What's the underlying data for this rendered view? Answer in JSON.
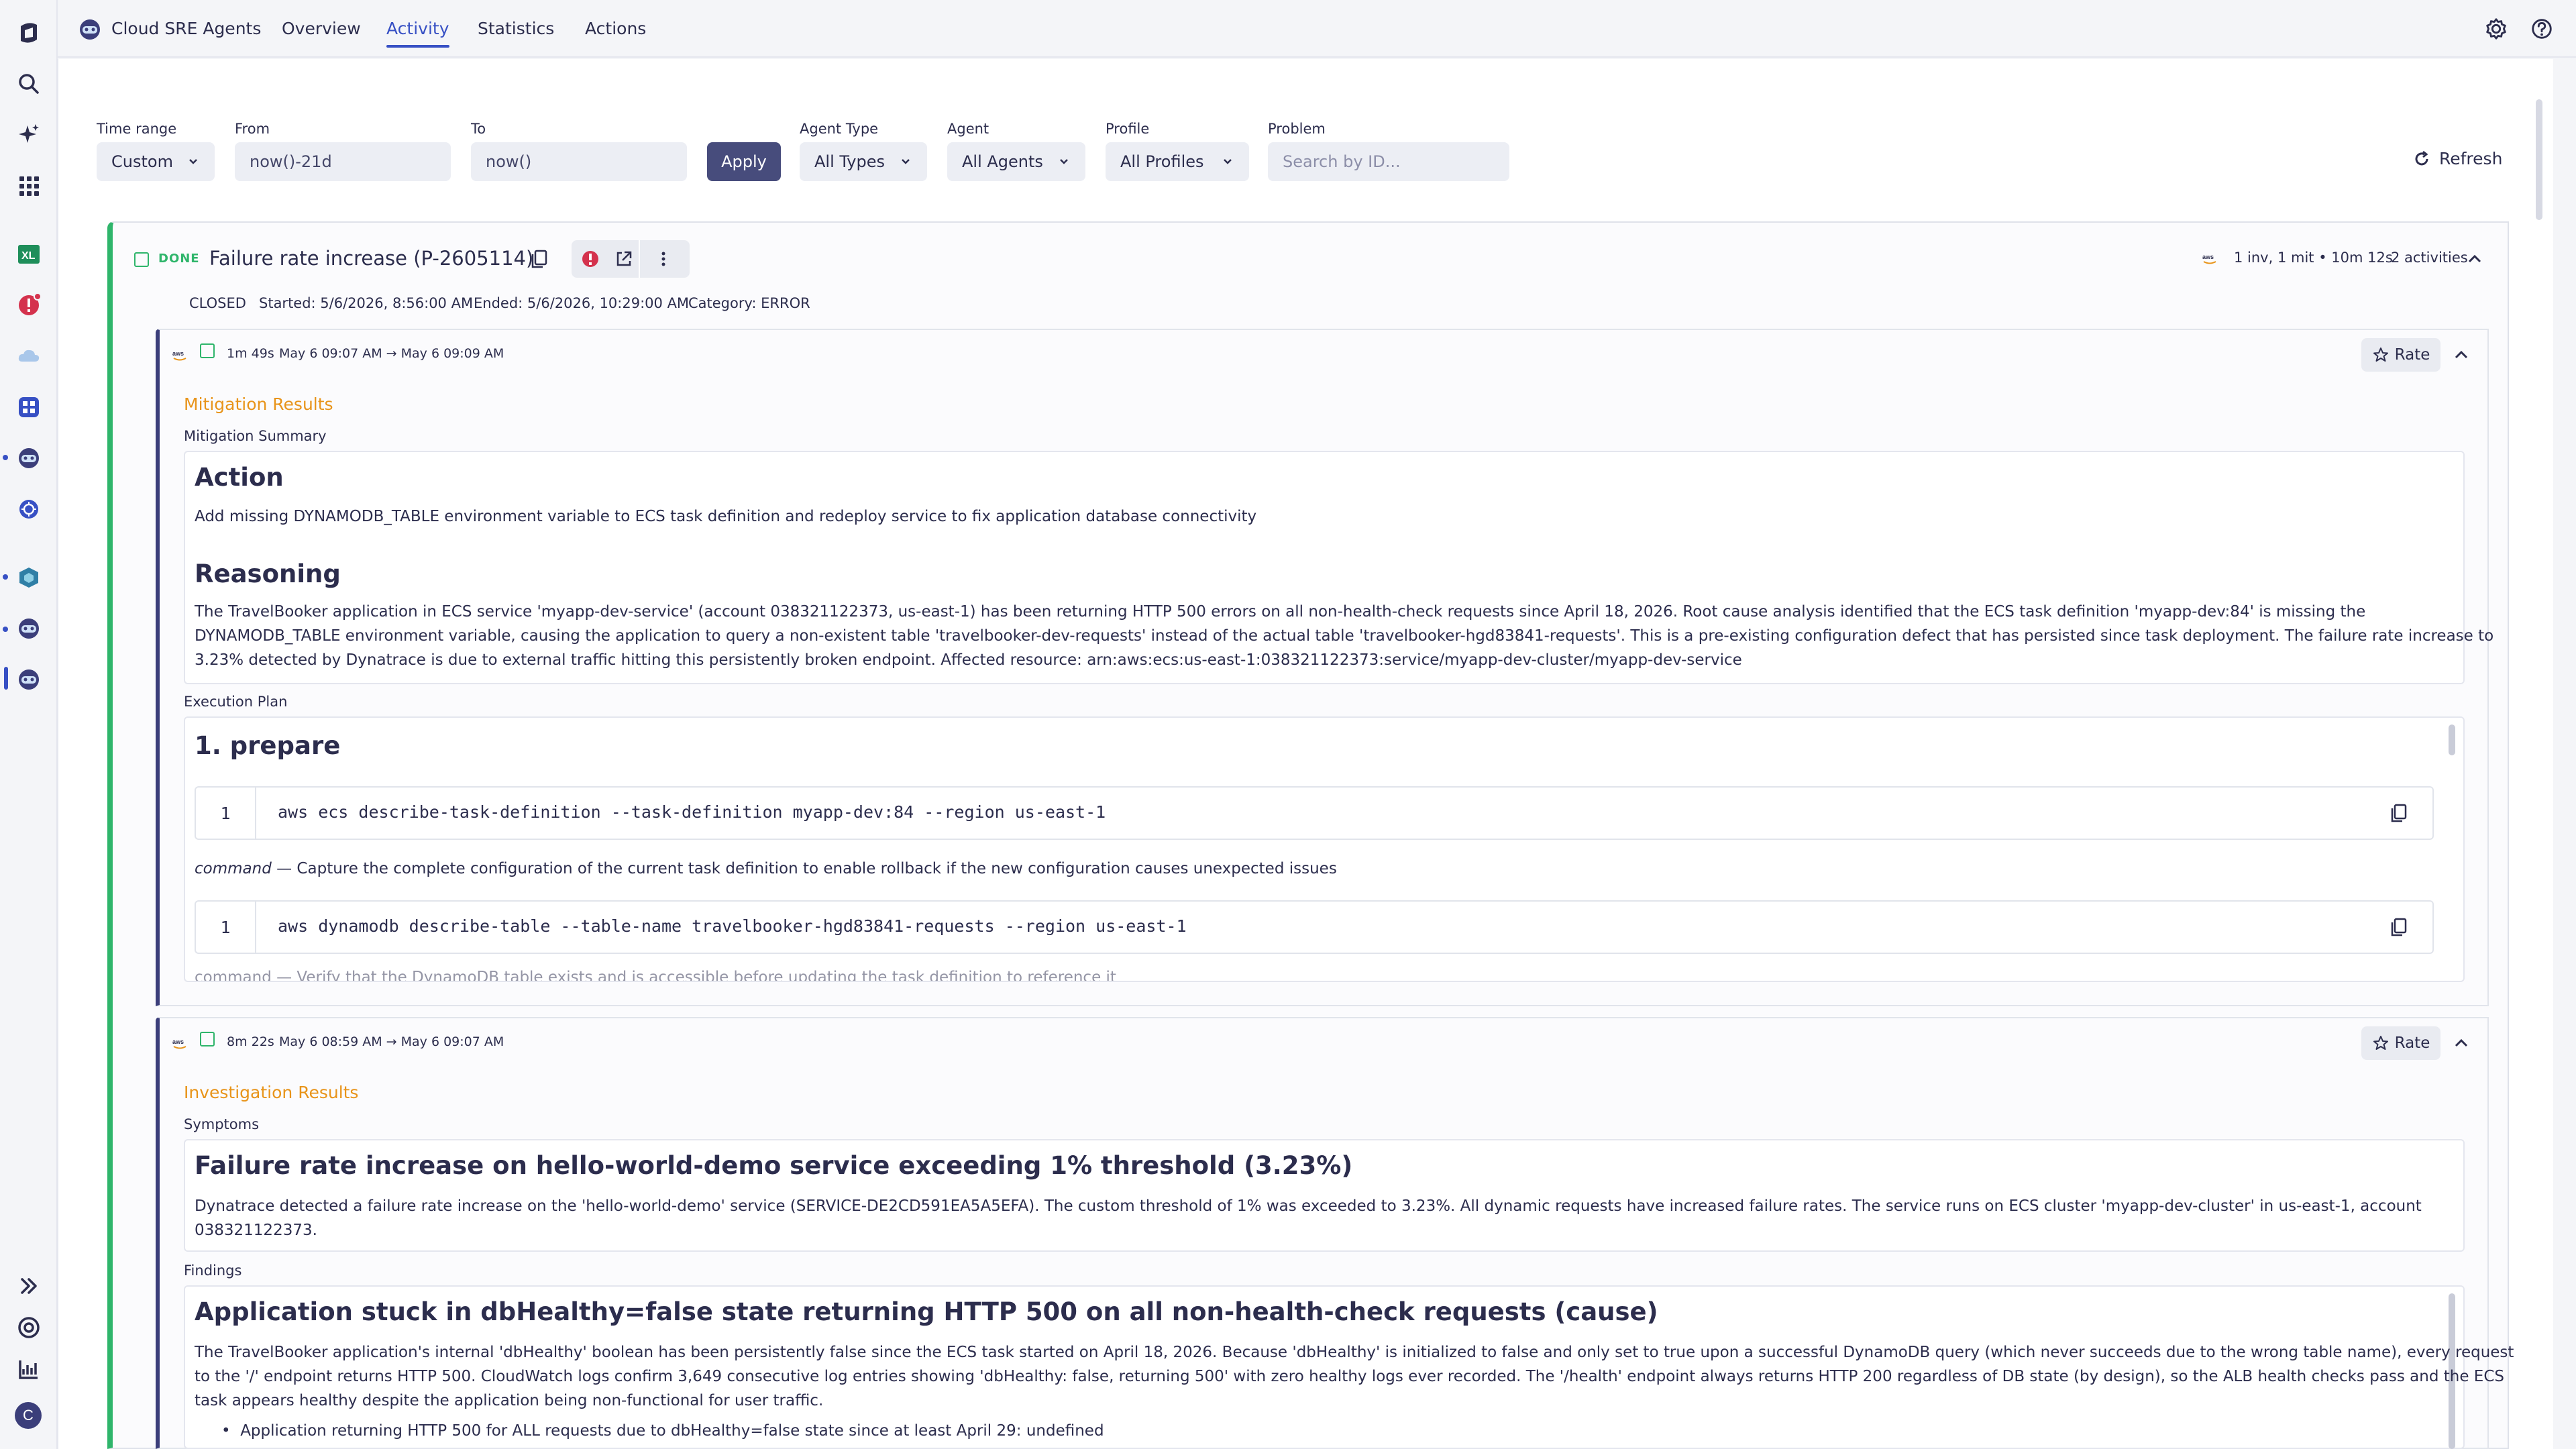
{
  "nav": {
    "app_name": "Cloud SRE Agents",
    "tabs": [
      {
        "label": "Overview"
      },
      {
        "label": "Activity"
      },
      {
        "label": "Statistics"
      },
      {
        "label": "Actions"
      }
    ],
    "active_tab": "Activity"
  },
  "rail": {
    "avatar_initial": "C",
    "icons": [
      "home-icon",
      "search-icon",
      "sparkle-icon",
      "apps-grid-icon",
      "spreadsheet-icon",
      "problems-icon",
      "cloud-icon",
      "dashboard-icon",
      "agent-icon",
      "kubernetes-icon",
      "app-cube-icon",
      "agent-icon",
      "agent-icon",
      "expand-icon",
      "support-icon",
      "chart-icon"
    ]
  },
  "filters": {
    "time_range_label": "Time range",
    "time_range_value": "Custom",
    "from_label": "From",
    "from_value": "now()-21d",
    "to_label": "To",
    "to_value": "now()",
    "apply_label": "Apply",
    "agent_type_label": "Agent Type",
    "agent_type_value": "All Types",
    "agent_label": "Agent",
    "agent_value": "All Agents",
    "profile_label": "Profile",
    "profile_value": "All Profiles",
    "problem_label": "Problem",
    "problem_placeholder": "Search by ID...",
    "refresh_label": "Refresh"
  },
  "problem": {
    "status": "DONE",
    "title": "Failure rate increase (P-2605114)",
    "summary_right": "1 inv, 1 mit • 10m 12s",
    "activities_count": "2 activities",
    "state": "CLOSED",
    "started": "Started: 5/6/2026, 8:56:00 AM",
    "ended": "Ended: 5/6/2026, 10:29:00 AM",
    "category": "Category: ERROR"
  },
  "mitigation": {
    "duration": "1m 49s",
    "range": "May 6 09:07 AM → May 6 09:09 AM",
    "rate_label": "Rate",
    "section_title": "Mitigation Results",
    "summary_label": "Mitigation Summary",
    "action_heading": "Action",
    "action_text": "Add missing DYNAMODB_TABLE environment variable to ECS task definition and redeploy service to fix application database connectivity",
    "reasoning_heading": "Reasoning",
    "reasoning_lines": [
      "The TravelBooker application in ECS service 'myapp-dev-service' (account 038321122373, us-east-1) has been returning HTTP 500 errors on all non-health-check requests since April 18, 2026. Root cause analysis identified that the ECS task definition 'myapp-dev:84' is missing the",
      "DYNAMODB_TABLE environment variable, causing the application to query a non-existent table 'travelbooker-dev-requests' instead of the actual table 'travelbooker-hgd83841-requests'. This is a pre-existing configuration defect that has persisted since task deployment. The failure rate increase to",
      "3.23% detected by Dynatrace is due to external traffic hitting this persistently broken endpoint. Affected resource: arn:aws:ecs:us-east-1:038321122373:service/myapp-dev-cluster/myapp-dev-service"
    ],
    "plan_label": "Execution Plan",
    "plan_heading": "1. prepare",
    "code1_num": "1",
    "code1": "aws ecs describe-task-definition --task-definition myapp-dev:84 --region us-east-1",
    "note_em": "command",
    "note_text": " — Capture the complete configuration of the current task definition to enable rollback if the new configuration causes unexpected issues",
    "code2_num": "1",
    "code2": "aws dynamodb describe-table --table-name travelbooker-hgd83841-requests --region us-east-1",
    "cut_line": "command — Verify that the DynamoDB table exists and is accessible before updating the task definition to reference it"
  },
  "investigation": {
    "duration": "8m 22s",
    "range": "May 6 08:59 AM → May 6 09:07 AM",
    "rate_label": "Rate",
    "section_title": "Investigation Results",
    "symptoms_label": "Symptoms",
    "symptom_heading": "Failure rate increase on hello-world-demo service exceeding 1% threshold (3.23%)",
    "symptom_lines": [
      "Dynatrace detected a failure rate increase on the 'hello-world-demo' service (SERVICE-DE2CD591EA5A5EFA). The custom threshold of 1% was exceeded to 3.23%. All dynamic requests have increased failure rates. The service runs on ECS cluster 'myapp-dev-cluster' in us-east-1, account",
      "038321122373."
    ],
    "findings_label": "Findings",
    "finding_heading": "Application stuck in dbHealthy=false state returning HTTP 500 on all non-health-check requests (cause)",
    "finding_lines": [
      "The TravelBooker application's internal 'dbHealthy' boolean has been persistently false since the ECS task started on April 18, 2026. Because 'dbHealthy' is initialized to false and only set to true upon a successful DynamoDB query (which never succeeds due to the wrong table name), every request",
      "to the '/' endpoint returns HTTP 500. CloudWatch logs confirm 3,649 consecutive log entries showing 'dbHealthy: false, returning 500' with zero healthy logs ever recorded. The '/health' endpoint always returns HTTP 200 regardless of DB state (by design), so the ALB health checks pass and the ECS",
      "task appears healthy despite the application being non-functional for user traffic."
    ],
    "bullet_strong": "Application returning HTTP 500 for ALL requests due to dbHealthy=false state since at least April 29:",
    "bullet_rest": " undefined"
  }
}
